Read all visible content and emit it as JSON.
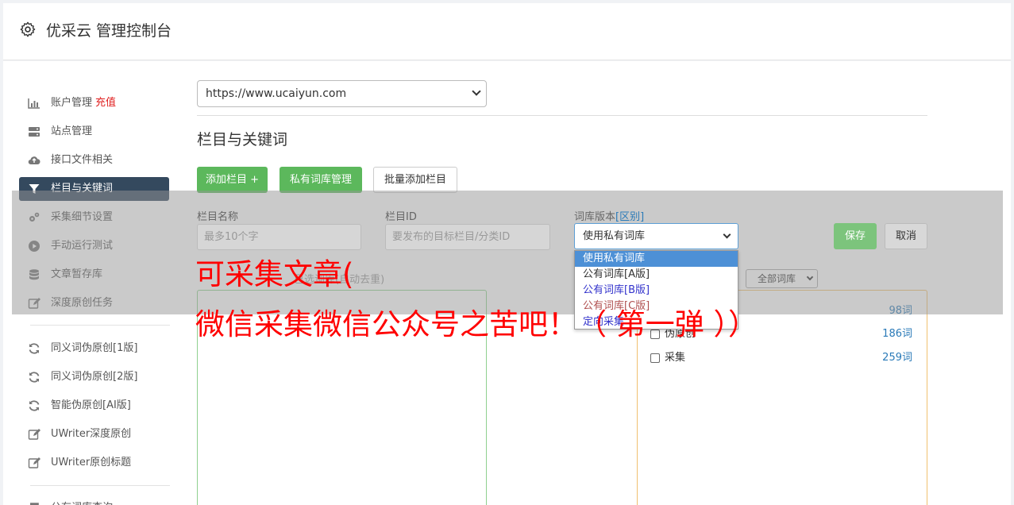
{
  "header": {
    "title": "优采云 管理控制台"
  },
  "sidebar": {
    "items": [
      {
        "label": "账户管理",
        "badge": "充值",
        "icon": "bar-chart-icon"
      },
      {
        "label": "站点管理",
        "icon": "server-icon"
      },
      {
        "label": "接口文件相关",
        "icon": "cloud-upload-icon"
      },
      {
        "label": "栏目与关键词",
        "icon": "filter-icon",
        "active": true
      },
      {
        "label": "采集细节设置",
        "icon": "gears-icon"
      },
      {
        "label": "手动运行测试",
        "icon": "play-circle-icon"
      },
      {
        "label": "文章暂存库",
        "icon": "database-icon"
      },
      {
        "label": "深度原创任务",
        "icon": "edit-icon"
      },
      {
        "label": "同义词伪原创[1版]",
        "icon": "refresh-icon"
      },
      {
        "label": "同义词伪原创[2版]",
        "icon": "refresh-icon"
      },
      {
        "label": "智能伪原创[AI版]",
        "icon": "refresh-icon"
      },
      {
        "label": "UWriter深度原创",
        "icon": "edit-icon"
      },
      {
        "label": "UWriter原创标题",
        "icon": "edit-icon"
      },
      {
        "label": "公有词库查询",
        "icon": "book-icon"
      }
    ]
  },
  "main": {
    "site_select_value": "https://www.ucaiyun.com",
    "section_title": "栏目与关键词",
    "buttons": {
      "add_column": "添加栏目 +",
      "private_lexicon": "私有词库管理",
      "batch_add": "批量添加栏目"
    },
    "form": {
      "name_label": "栏目名称",
      "name_placeholder": "最多10个字",
      "id_label": "栏目ID",
      "id_placeholder": "要发布的目标栏目/分类ID",
      "version_label": "词库版本",
      "version_link": "[区别]",
      "version_value": "使用私有词库",
      "save": "保存",
      "cancel": "取消"
    },
    "version_options": [
      "使用私有词库",
      "公有词库[A版]",
      "公有词库[B版]",
      "公有词库[C版]",
      "定向采集"
    ],
    "selected_hint": "已选词库(自动去重)",
    "lexicon_filter": "全部词库",
    "lexicon_list": [
      {
        "name": "",
        "count": "98词"
      },
      {
        "name": "伪原创",
        "count": "186词"
      },
      {
        "name": "采集",
        "count": "259词"
      }
    ]
  },
  "caption": {
    "line1": "可采集文章(",
    "line2": "微信采集微信公众号之苦吧！（ 第一弹 ））"
  },
  "colors": {
    "active_nav": "#34495e",
    "green_button": "#5cb85c",
    "caption_red": "#ff0000",
    "link_blue": "#2a7ab8"
  }
}
